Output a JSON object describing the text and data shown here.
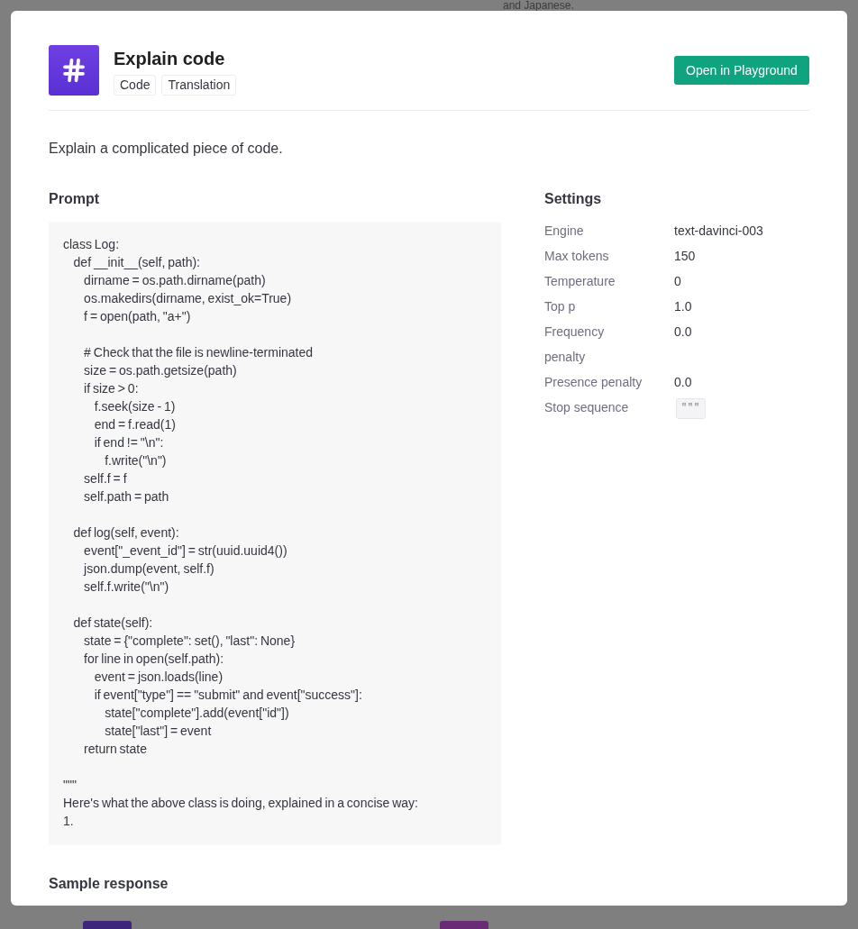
{
  "background": {
    "text": "and Japanese.",
    "tiles": [
      {
        "color": "#3d2679"
      },
      {
        "color": "#6a2b76"
      }
    ]
  },
  "header": {
    "title": "Explain code",
    "tags": [
      "Code",
      "Translation"
    ],
    "button": "Open in Playground"
  },
  "description": "Explain a complicated piece of code.",
  "prompt": {
    "heading": "Prompt",
    "code": "class Log:\n    def __init__(self, path):\n        dirname = os.path.dirname(path)\n        os.makedirs(dirname, exist_ok=True)\n        f = open(path, \"a+\")\n\n        # Check that the file is newline-terminated\n        size = os.path.getsize(path)\n        if size > 0:\n            f.seek(size - 1)\n            end = f.read(1)\n            if end != \"\\n\":\n                f.write(\"\\n\")\n        self.f = f\n        self.path = path\n\n    def log(self, event):\n        event[\"_event_id\"] = str(uuid.uuid4())\n        json.dump(event, self.f)\n        self.f.write(\"\\n\")\n\n    def state(self):\n        state = {\"complete\": set(), \"last\": None}\n        for line in open(self.path):\n            event = json.loads(line)\n            if event[\"type\"] == \"submit\" and event[\"success\"]:\n                state[\"complete\"].add(event[\"id\"])\n                state[\"last\"] = event\n        return state\n\n\"\"\"\nHere's what the above class is doing, explained in a concise way:\n1."
  },
  "settings": {
    "heading": "Settings",
    "rows": [
      {
        "kind": "text",
        "label": "Engine",
        "value": "text-davinci-003"
      },
      {
        "kind": "text",
        "label": "Max tokens",
        "value": "150"
      },
      {
        "kind": "text",
        "label": "Temperature",
        "value": "0"
      },
      {
        "kind": "text",
        "label": "Top p",
        "value": "1.0"
      },
      {
        "kind": "text",
        "label": "Frequency penalty",
        "value": "0.0"
      },
      {
        "kind": "text",
        "label": "Presence penalty",
        "value": "0.0"
      },
      {
        "kind": "chip",
        "label": "Stop sequence",
        "value": "\"\"\""
      }
    ]
  },
  "sample_response": {
    "heading": "Sample response"
  }
}
